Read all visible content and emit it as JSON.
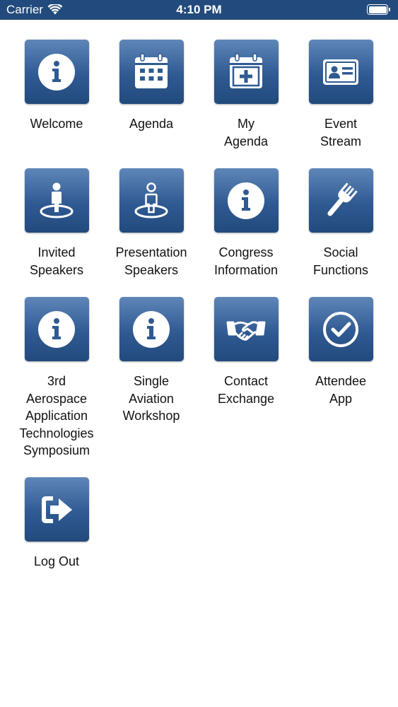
{
  "status_bar": {
    "carrier": "Carrier",
    "time": "4:10 PM"
  },
  "colors": {
    "accent": "#224a7c",
    "tile_gradient_top": "#5f86b8",
    "tile_gradient_bottom": "#224a7c"
  },
  "tiles": [
    {
      "label": "Welcome",
      "icon": "info-icon"
    },
    {
      "label": "Agenda",
      "icon": "calendar-icon"
    },
    {
      "label": "My\nAgenda",
      "icon": "calendar-plus-icon"
    },
    {
      "label": "Event\nStream",
      "icon": "id-card-icon"
    },
    {
      "label": "Invited\nSpeakers",
      "icon": "person-pin-icon"
    },
    {
      "label": "Presentation\nSpeakers",
      "icon": "person-outline-pin-icon"
    },
    {
      "label": "Congress\nInformation",
      "icon": "info-icon"
    },
    {
      "label": "Social\nFunctions",
      "icon": "fork-icon"
    },
    {
      "label": "3rd\nAerospace\nApplication\nTechnologies\nSymposium",
      "icon": "info-icon"
    },
    {
      "label": "Single\nAviation\nWorkshop",
      "icon": "info-icon"
    },
    {
      "label": "Contact\nExchange",
      "icon": "handshake-icon"
    },
    {
      "label": "Attendee\nApp",
      "icon": "check-circle-icon"
    },
    {
      "label": "Log Out",
      "icon": "logout-icon"
    }
  ]
}
